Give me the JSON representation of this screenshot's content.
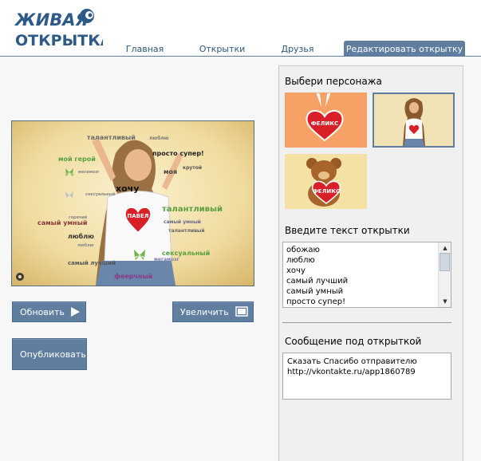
{
  "header": {
    "logo_line1": "ЖИВАЯ",
    "logo_line2": "ОТКРЫТКА",
    "tabs": [
      {
        "label": "Главная"
      },
      {
        "label": "Открытки"
      },
      {
        "label": "Друзья"
      },
      {
        "label": "Редактировать открытку",
        "active": true
      }
    ]
  },
  "preview": {
    "name_on_heart": "ПАВЕЛ",
    "words": [
      "талантливый",
      "люблю",
      "мой герой",
      "просто супер!",
      "крутой",
      "хочу",
      "моя",
      "мегамозг",
      "сексуальный",
      "талантливый",
      "самый умный",
      "люблю",
      "талантливый",
      "сексуальный",
      "самый лучший",
      "мегамозг",
      "феерчный",
      "люблю",
      "горячий",
      "самый умный"
    ]
  },
  "buttons": {
    "refresh": "Обновить",
    "enlarge": "Увеличить",
    "publish": "Опубликовать"
  },
  "sidebar": {
    "choose_character_title": "Выбери персонажа",
    "characters": [
      {
        "label": "ФЕЛИКС",
        "kind": "bunny-heart"
      },
      {
        "label": "",
        "kind": "girl",
        "selected": true
      },
      {
        "label": "ФЕЛИКС",
        "kind": "bear-heart"
      }
    ],
    "card_text_title": "Введите текст открытки",
    "card_text_lines": [
      "обожаю",
      "люблю",
      "хочу",
      "самый лучший",
      "самый умный",
      "просто супер!"
    ],
    "message_title": "Сообщение под открыткой",
    "message_line1": "Сказать Спасибо отправителю",
    "message_line2": "http://vkontakte.ru/app1860789"
  },
  "colors": {
    "accent": "#5f7ea0",
    "link": "#2b587a",
    "heart": "#d92029"
  }
}
